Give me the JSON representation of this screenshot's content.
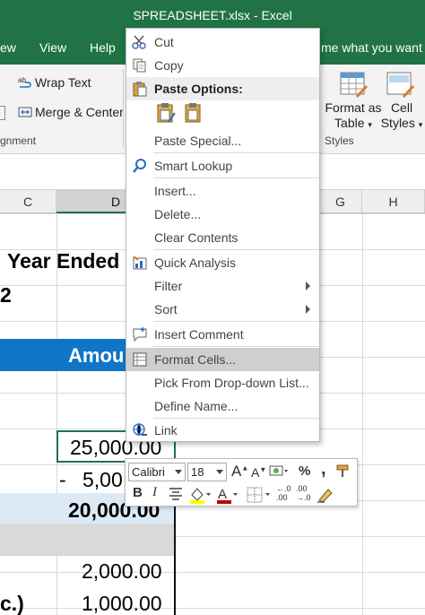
{
  "window": {
    "title": "SPREADSHEET.xlsx  -  Excel"
  },
  "ribbon_tabs": [
    "ew",
    "View",
    "Help"
  ],
  "tell_me": "me what you want to",
  "ribbon": {
    "wrap_text": "Wrap Text",
    "merge_center": "Merge & Center",
    "alignment_group": "gnment",
    "format_as_table": [
      "Format as",
      "Table"
    ],
    "cell_styles": [
      "Cell",
      "Styles"
    ],
    "styles_group": "Styles"
  },
  "columns": [
    "C",
    "D",
    "G",
    "H"
  ],
  "sheet": {
    "title_line1": "Year Ended",
    "title_line2": "2",
    "amount_header": "Amou",
    "value_1": "25,000.00",
    "value_2_prefix": "-",
    "value_2": "5,00",
    "value_3": "20,000.00",
    "value_4": "2,000.00",
    "row_label_c": "c.)",
    "value_5": "1,000.00"
  },
  "context_menu": {
    "cut": "Cut",
    "copy": "Copy",
    "paste_options": "Paste Options:",
    "paste_special": "Paste Special...",
    "smart_lookup": "Smart Lookup",
    "insert": "Insert...",
    "delete": "Delete...",
    "clear_contents": "Clear Contents",
    "quick_analysis": "Quick Analysis",
    "filter": "Filter",
    "sort": "Sort",
    "insert_comment": "Insert Comment",
    "format_cells": "Format Cells...",
    "pick_dropdown": "Pick From Drop-down List...",
    "define_name": "Define Name...",
    "link": "Link"
  },
  "mini_toolbar": {
    "font_name": "Calibri",
    "font_size": "18",
    "bold": "B",
    "italic": "I",
    "percent": "%",
    "comma": ","
  },
  "colors": {
    "excel_green": "#217346",
    "header_blue": "#0f75c8",
    "highlight_gray": "#cfcfcf"
  }
}
